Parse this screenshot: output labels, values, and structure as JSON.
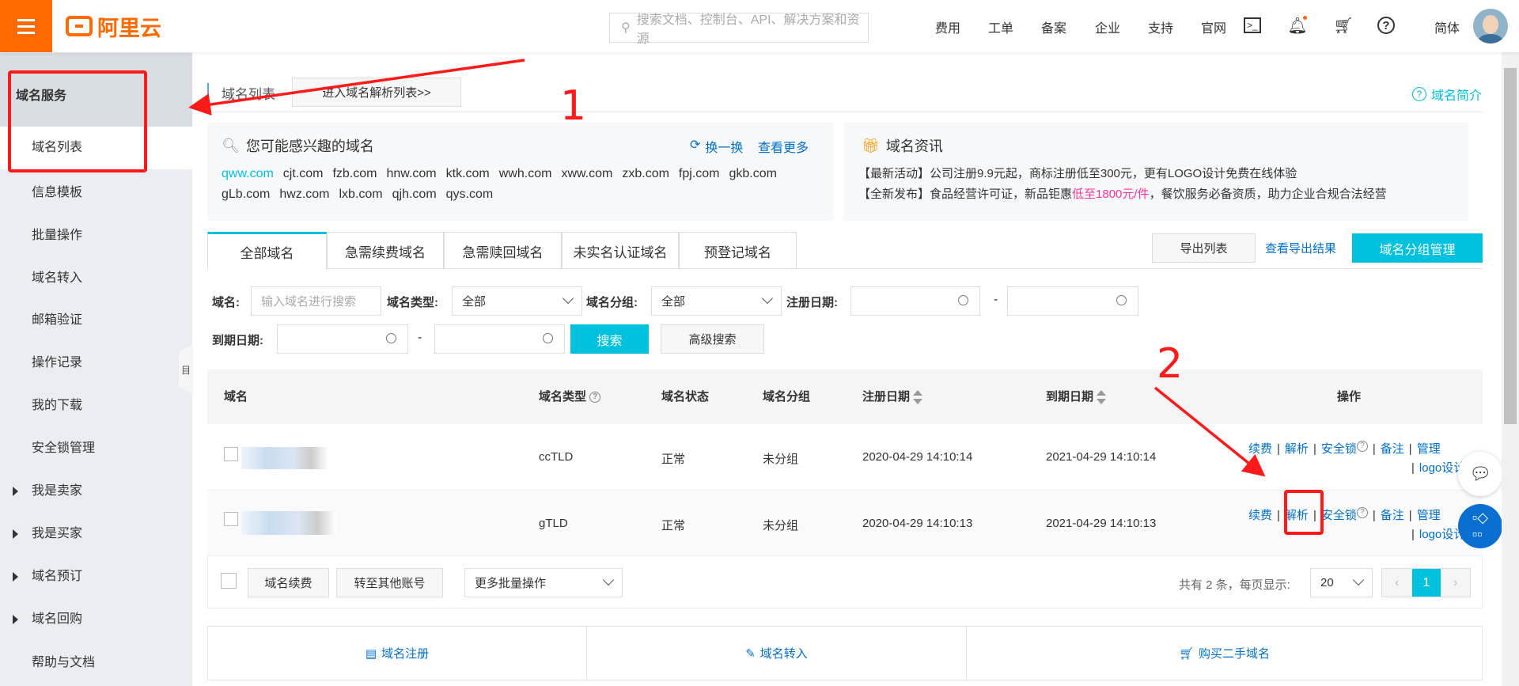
{
  "header": {
    "brand": "阿里云",
    "search_placeholder": "搜索文档、控制台、API、解决方案和资源",
    "nav": [
      "费用",
      "工单",
      "备案",
      "企业",
      "支持",
      "官网"
    ],
    "lang": "简体",
    "icons": [
      "terminal-icon",
      "bell-icon",
      "cart-icon",
      "help-icon"
    ]
  },
  "sidebar": {
    "section": "域名服务",
    "items": [
      {
        "label": "域名列表",
        "active": true
      },
      {
        "label": "信息模板"
      },
      {
        "label": "批量操作"
      },
      {
        "label": "域名转入"
      },
      {
        "label": "邮箱验证"
      },
      {
        "label": "操作记录"
      },
      {
        "label": "我的下载"
      },
      {
        "label": "安全锁管理"
      },
      {
        "label": "我是卖家",
        "expandable": true
      },
      {
        "label": "我是买家",
        "expandable": true
      },
      {
        "label": "域名预订",
        "expandable": true
      },
      {
        "label": "域名回购",
        "expandable": true
      },
      {
        "label": "帮助与文档"
      }
    ],
    "collapse_label": "目"
  },
  "page": {
    "title": "域名列表",
    "dns_list_button": "进入域名解析列表>>",
    "intro_link": "域名简介"
  },
  "suggest": {
    "title": "您可能感兴趣的域名",
    "refresh": "换一换",
    "more": "查看更多",
    "domains": [
      "qww.com",
      "cjt.com",
      "fzb.com",
      "hnw.com",
      "ktk.com",
      "wwh.com",
      "xww.com",
      "zxb.com",
      "fpj.com",
      "gkb.com",
      "gLb.com",
      "hwz.com",
      "lxb.com",
      "qjh.com",
      "qys.com"
    ]
  },
  "news": {
    "title": "域名资讯",
    "line1": "【最新活动】公司注册9.9元起，商标注册低至300元，更有LOGO设计免费在线体验",
    "line2_a": "【全新发布】食品经营许可证，新品钜惠",
    "line2_highlight": "低至1800元/件",
    "line2_b": "，餐饮服务必备资质，助力企业合规合法经营",
    "highlight_color": "#ff3399"
  },
  "tabs": [
    "全部域名",
    "急需续费域名",
    "急需赎回域名",
    "未实名认证域名",
    "预登记域名"
  ],
  "actions": {
    "export": "导出列表",
    "view_export": "查看导出结果",
    "group_manage": "域名分组管理"
  },
  "filters": {
    "domain_label": "域名:",
    "domain_placeholder": "输入域名进行搜索",
    "type_label": "域名类型:",
    "type_value": "全部",
    "group_label": "域名分组:",
    "group_value": "全部",
    "reg_label": "注册日期:",
    "exp_label": "到期日期:",
    "dash": "-",
    "search": "搜索",
    "advanced": "高级搜索"
  },
  "table": {
    "headers": [
      "域名",
      "域名类型",
      "域名状态",
      "域名分组",
      "注册日期",
      "到期日期",
      "操作"
    ],
    "rows": [
      {
        "type": "ccTLD",
        "status": "正常",
        "group": "未分组",
        "reg": "2020-04-29 14:10:14",
        "exp": "2021-04-29 14:10:14"
      },
      {
        "type": "gTLD",
        "status": "正常",
        "group": "未分组",
        "reg": "2020-04-29 14:10:13",
        "exp": "2021-04-29 14:10:13"
      }
    ],
    "ops": [
      "续费",
      "解析",
      "安全锁",
      "备注",
      "管理",
      "logo设计"
    ]
  },
  "footer": {
    "renew": "域名续费",
    "transfer": "转至其他账号",
    "more_batch": "更多批量操作",
    "total": "共有 2 条，每页显示:",
    "page_size": "20",
    "current_page": "1"
  },
  "quicklinks": [
    "域名注册",
    "域名转入",
    "购买二手域名"
  ],
  "annotations": {
    "step1": "1",
    "step2": "2"
  },
  "colors": {
    "accent": "#00c1de",
    "brand": "#ff6a00",
    "link": "#0070cc",
    "annotation": "#ff1a1a"
  }
}
